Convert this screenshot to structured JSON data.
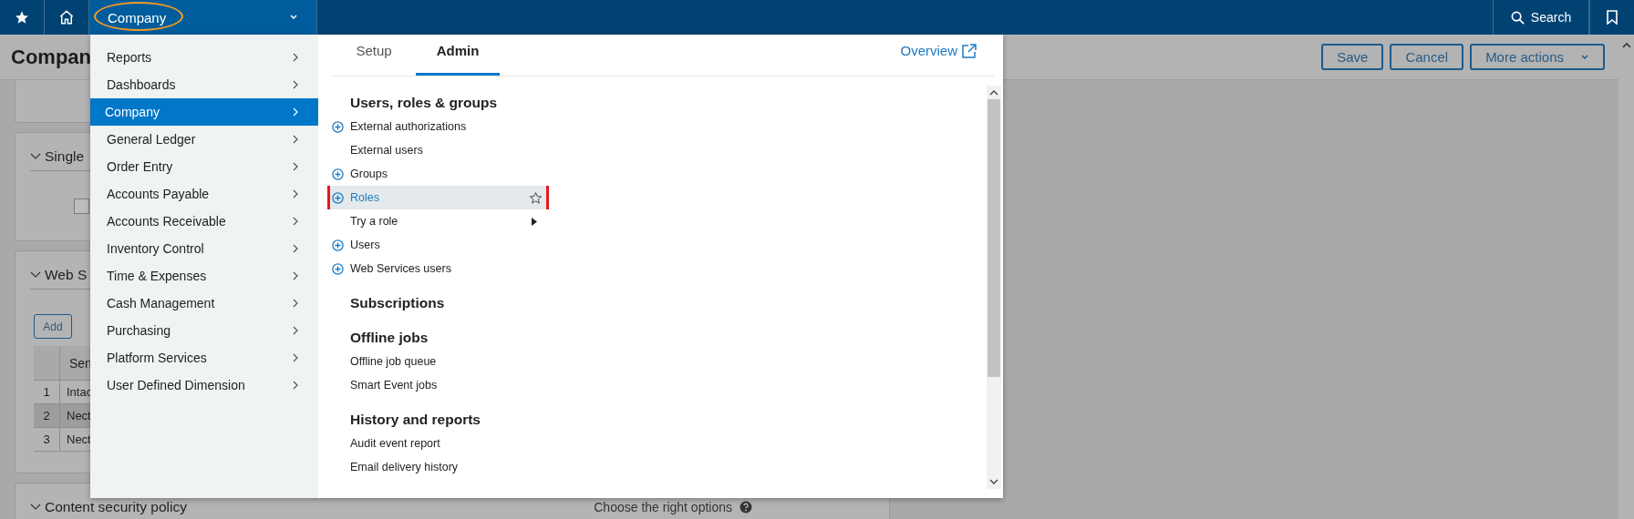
{
  "top_bar": {
    "module": "Company",
    "search": "Search"
  },
  "page": {
    "title": "Compan",
    "actions": [
      "Save",
      "Cancel",
      "More actions"
    ],
    "sections": [
      {
        "kind": "stub"
      },
      {
        "kind": "checkbox",
        "title": "Single",
        "checked": false
      },
      {
        "kind": "table",
        "title": "Web S",
        "button": "Add",
        "column_1": "Sen",
        "rows": [
          {
            "index": "1",
            "cell": "Intac",
            "selected": false
          },
          {
            "index": "2",
            "cell": "Nect",
            "selected": true
          },
          {
            "index": "3",
            "cell": "Nect",
            "selected": false
          }
        ]
      },
      {
        "kind": "plain",
        "title": "Content security policy",
        "hint": "Choose the right options"
      }
    ]
  },
  "menu": {
    "items": [
      {
        "label": "Reports",
        "selected": false
      },
      {
        "label": "Dashboards",
        "selected": false
      },
      {
        "label": "Company",
        "selected": true
      },
      {
        "label": "General Ledger",
        "selected": false
      },
      {
        "label": "Order Entry",
        "selected": false
      },
      {
        "label": "Accounts Payable",
        "selected": false
      },
      {
        "label": "Accounts Receivable",
        "selected": false
      },
      {
        "label": "Inventory Control",
        "selected": false
      },
      {
        "label": "Time & Expenses",
        "selected": false
      },
      {
        "label": "Cash Management",
        "selected": false
      },
      {
        "label": "Purchasing",
        "selected": false
      },
      {
        "label": "Platform Services",
        "selected": false
      },
      {
        "label": "User Defined Dimension",
        "selected": false
      }
    ],
    "tabs": [
      {
        "label": "Setup",
        "selected": false
      },
      {
        "label": "Admin",
        "selected": true
      }
    ],
    "overview": "Overview",
    "groups": [
      {
        "title": "Users, roles & groups",
        "items": [
          {
            "label": "External authorizations",
            "add": true,
            "selected": false,
            "submenu": false
          },
          {
            "label": "External users",
            "add": false,
            "selected": false,
            "submenu": false
          },
          {
            "label": "Groups",
            "add": true,
            "selected": false,
            "submenu": false
          },
          {
            "label": "Roles",
            "add": true,
            "selected": true,
            "submenu": false
          },
          {
            "label": "Try a role",
            "add": false,
            "selected": false,
            "submenu": true
          },
          {
            "label": "Users",
            "add": true,
            "selected": false,
            "submenu": false
          },
          {
            "label": "Web Services users",
            "add": true,
            "selected": false,
            "submenu": false
          }
        ]
      },
      {
        "title": "Subscriptions"
      },
      {
        "title": "Offline jobs",
        "items": [
          {
            "label": "Offline job queue",
            "add": false,
            "selected": false,
            "submenu": false
          },
          {
            "label": "Smart Event jobs",
            "add": false,
            "selected": false,
            "submenu": false
          }
        ]
      },
      {
        "title": "History and reports",
        "items": [
          {
            "label": "Audit event report",
            "add": false,
            "selected": false,
            "submenu": false
          },
          {
            "label": "Email delivery history",
            "add": false,
            "selected": false,
            "submenu": false
          }
        ]
      }
    ]
  }
}
